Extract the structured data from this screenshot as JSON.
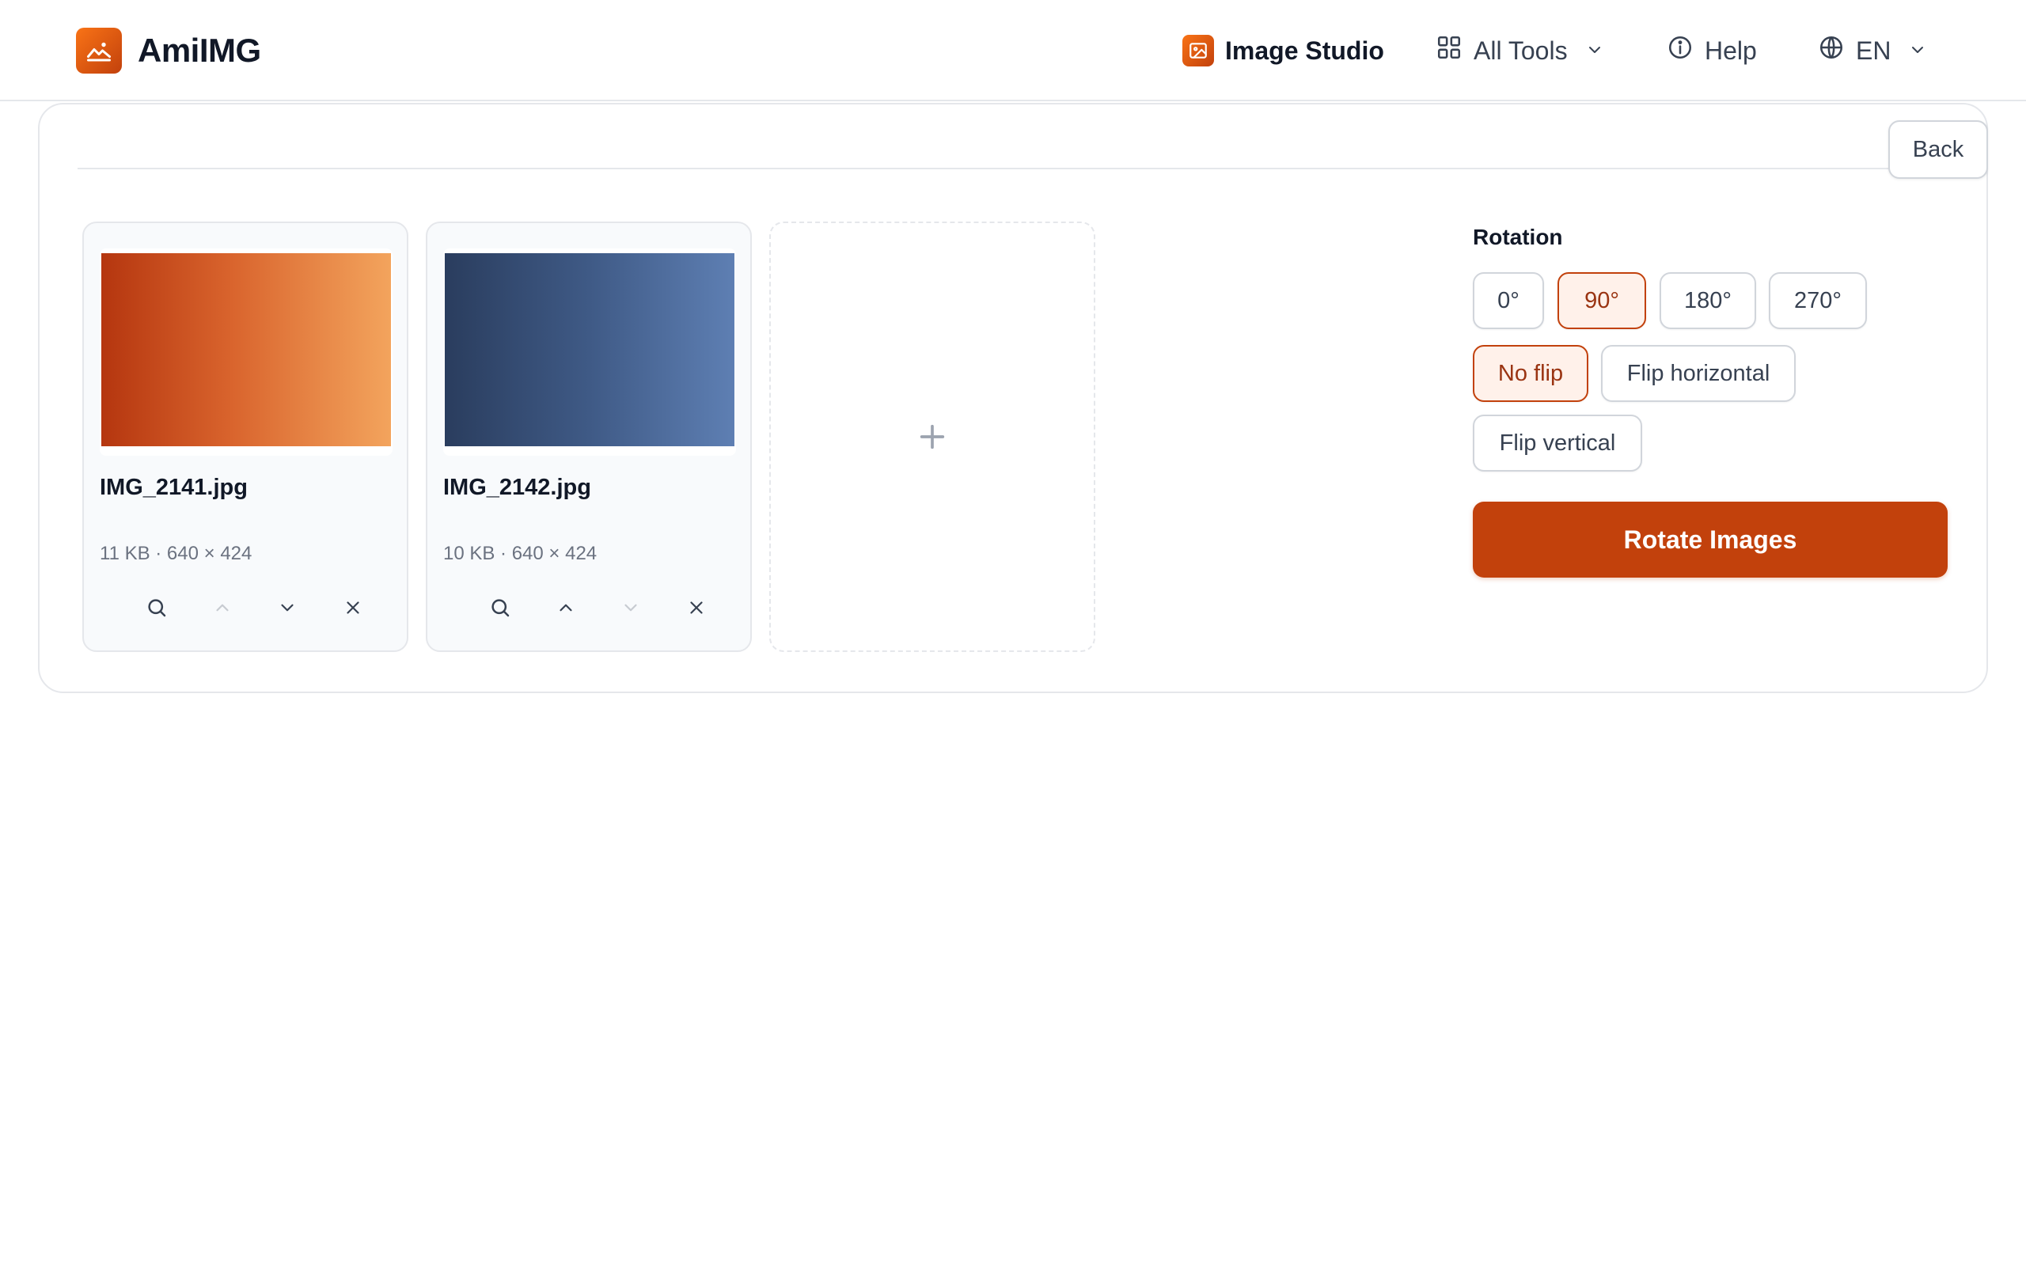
{
  "app": {
    "name": "AmiIMG"
  },
  "nav": {
    "studio": {
      "label": "Image Studio",
      "icon": "image-icon"
    },
    "tools": {
      "label": "All Tools",
      "icon": "grid-icon"
    },
    "help": {
      "label": "Help",
      "icon": "info-icon"
    },
    "language": {
      "label": "EN",
      "icon": "globe-icon"
    }
  },
  "panel": {
    "back_label": "Back"
  },
  "images": [
    {
      "name": "IMG_2141.jpg",
      "meta": "11 KB · 640 × 424",
      "thumb_color": "#d9642d",
      "move_up_enabled": false,
      "move_down_enabled": true
    },
    {
      "name": "IMG_2142.jpg",
      "meta": "10 KB · 640 × 424",
      "thumb_color": "#3f5a86",
      "move_up_enabled": true,
      "move_down_enabled": false
    }
  ],
  "add_image": {
    "icon": "plus-icon"
  },
  "options": {
    "rotation_label": "Rotation",
    "rotations": [
      "0°",
      "90°",
      "180°",
      "270°"
    ],
    "selected_rotation": "90°",
    "flips": [
      "No flip",
      "Flip horizontal",
      "Flip vertical"
    ],
    "selected_flip": "No flip"
  },
  "action": {
    "label": "Rotate Images"
  },
  "colors": {
    "accent": "#c2410c",
    "accent_soft": "#fff1ea",
    "border": "#e5e7eb"
  }
}
